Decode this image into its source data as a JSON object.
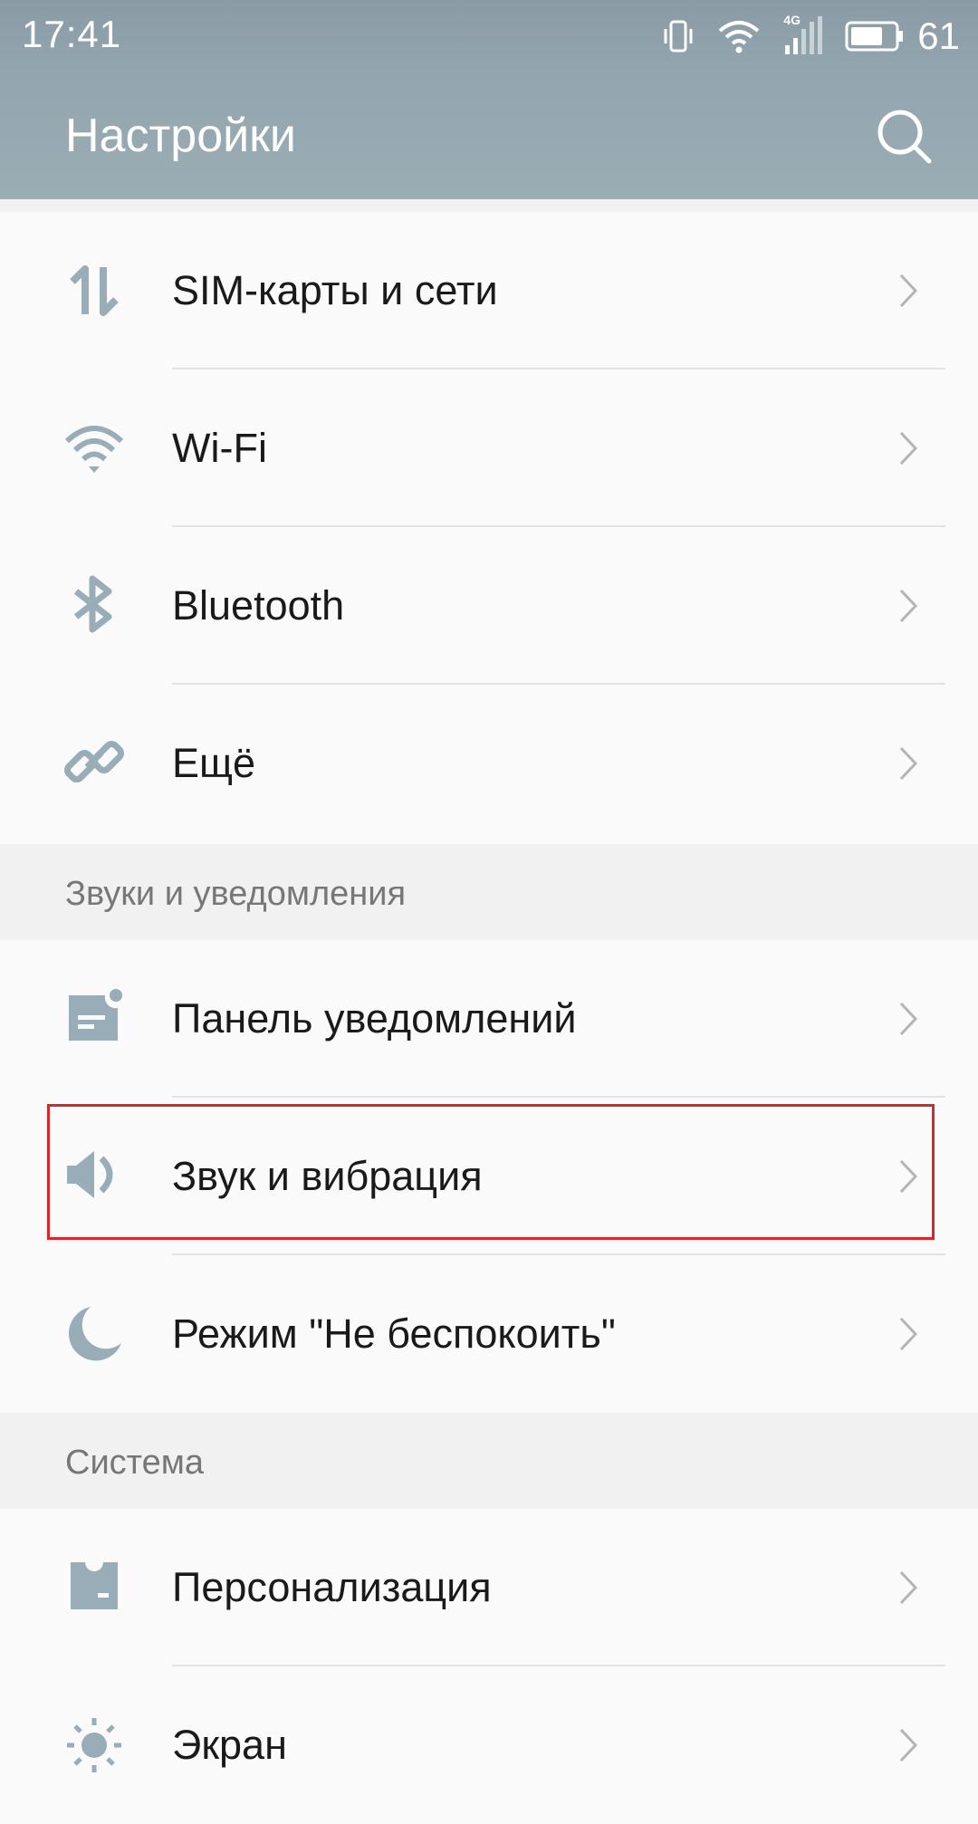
{
  "status_bar": {
    "time": "17:41",
    "battery_level": "61",
    "network_type": "4G",
    "icons": [
      "vibrate-icon",
      "wifi-icon",
      "signal-icon",
      "battery-icon"
    ]
  },
  "app_bar": {
    "title": "Настройки",
    "search_icon": "search-icon"
  },
  "network_group": {
    "items": [
      {
        "label": "SIM-карты и сети",
        "icon": "sim-transfer-icon"
      },
      {
        "label": "Wi-Fi",
        "icon": "wifi-icon"
      },
      {
        "label": "Bluetooth",
        "icon": "bluetooth-icon"
      },
      {
        "label": "Ещё",
        "icon": "link-icon"
      }
    ]
  },
  "sound_section": {
    "title": "Звуки и уведомления",
    "items": [
      {
        "label": "Панель уведомлений",
        "icon": "notification-panel-icon"
      },
      {
        "label": "Звук и вибрация",
        "icon": "speaker-icon"
      },
      {
        "label": "Режим \"Не беспокоить\"",
        "icon": "moon-icon"
      }
    ]
  },
  "system_section": {
    "title": "Система",
    "items": [
      {
        "label": "Персонализация",
        "icon": "personalization-icon"
      },
      {
        "label": "Экран",
        "icon": "brightness-icon"
      }
    ]
  },
  "colors": {
    "header": "#93a5ae",
    "icon": "#98adb7",
    "highlight": "#d6262e"
  }
}
